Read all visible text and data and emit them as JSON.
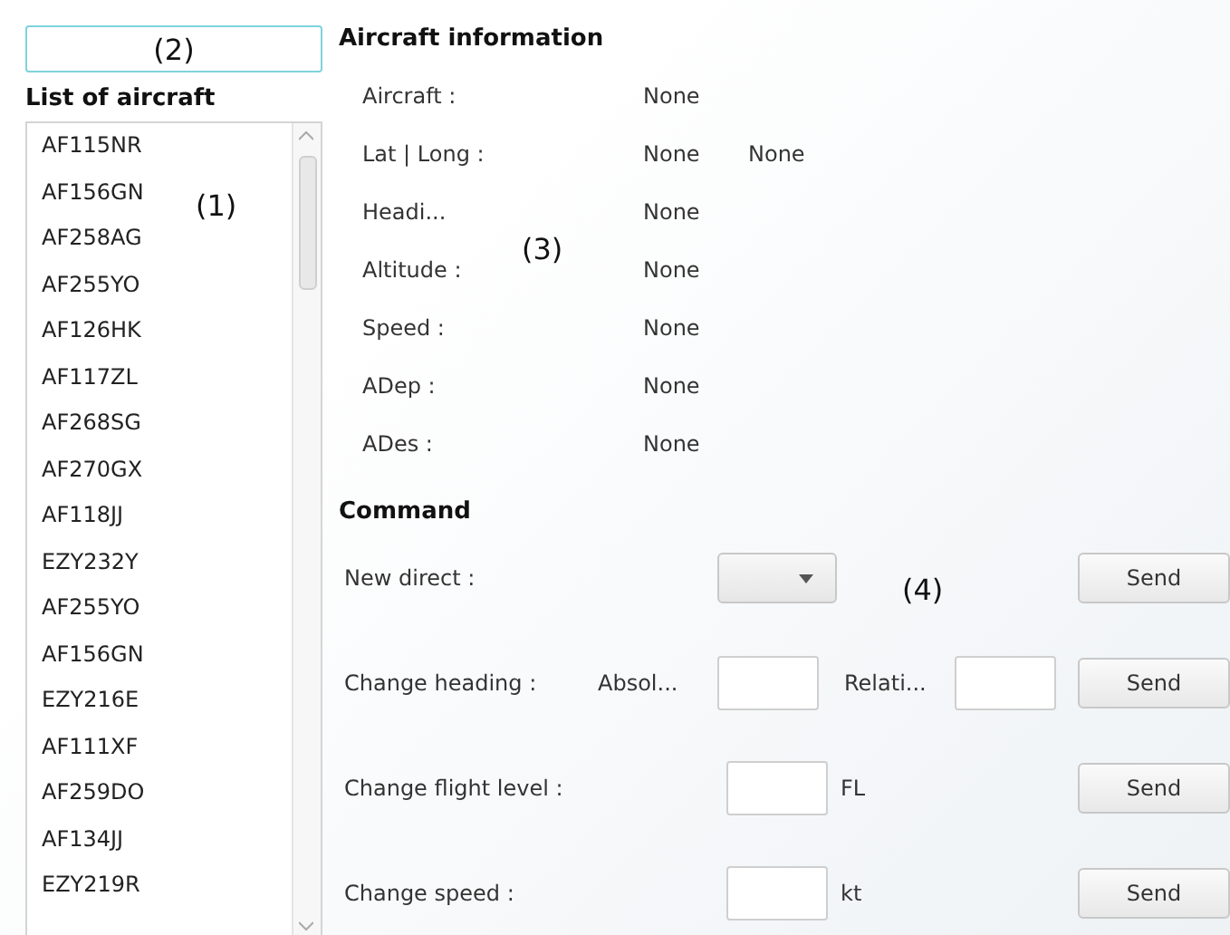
{
  "search": {
    "value": "(2)"
  },
  "aircraft_list": {
    "title": "List of aircraft",
    "items": [
      "AF115NR",
      "AF156GN",
      "AF258AG",
      "AF255YO",
      "AF126HK",
      "AF117ZL",
      "AF268SG",
      "AF270GX",
      "AF118JJ",
      "EZY232Y",
      "AF255YO",
      "AF156GN",
      "EZY216E",
      "AF111XF",
      "AF259DO",
      "AF134JJ",
      "EZY219R"
    ]
  },
  "info": {
    "title": "Aircraft information",
    "rows": [
      {
        "label": "Aircraft :",
        "values": [
          "None"
        ]
      },
      {
        "label": "Lat | Long :",
        "values": [
          "None",
          "None"
        ]
      },
      {
        "label": "Headi...",
        "values": [
          "None"
        ]
      },
      {
        "label": "Altitude :",
        "values": [
          "None"
        ]
      },
      {
        "label": "Speed :",
        "values": [
          "None"
        ]
      },
      {
        "label": "ADep :",
        "values": [
          "None"
        ]
      },
      {
        "label": "ADes :",
        "values": [
          "None"
        ]
      }
    ]
  },
  "command": {
    "title": "Command",
    "rows": [
      {
        "kind": "dropdown",
        "label": "New direct :",
        "button": "Send"
      },
      {
        "kind": "heading",
        "label": "Change heading :",
        "absolute": "Absol...",
        "relative": "Relati...",
        "button": "Send"
      },
      {
        "kind": "unit",
        "label": "Change flight level :",
        "unit": "FL",
        "button": "Send"
      },
      {
        "kind": "unit",
        "label": "Change speed :",
        "unit": "kt",
        "button": "Send"
      }
    ]
  },
  "annotations": [
    "(1)",
    "(3)",
    "(4)"
  ]
}
